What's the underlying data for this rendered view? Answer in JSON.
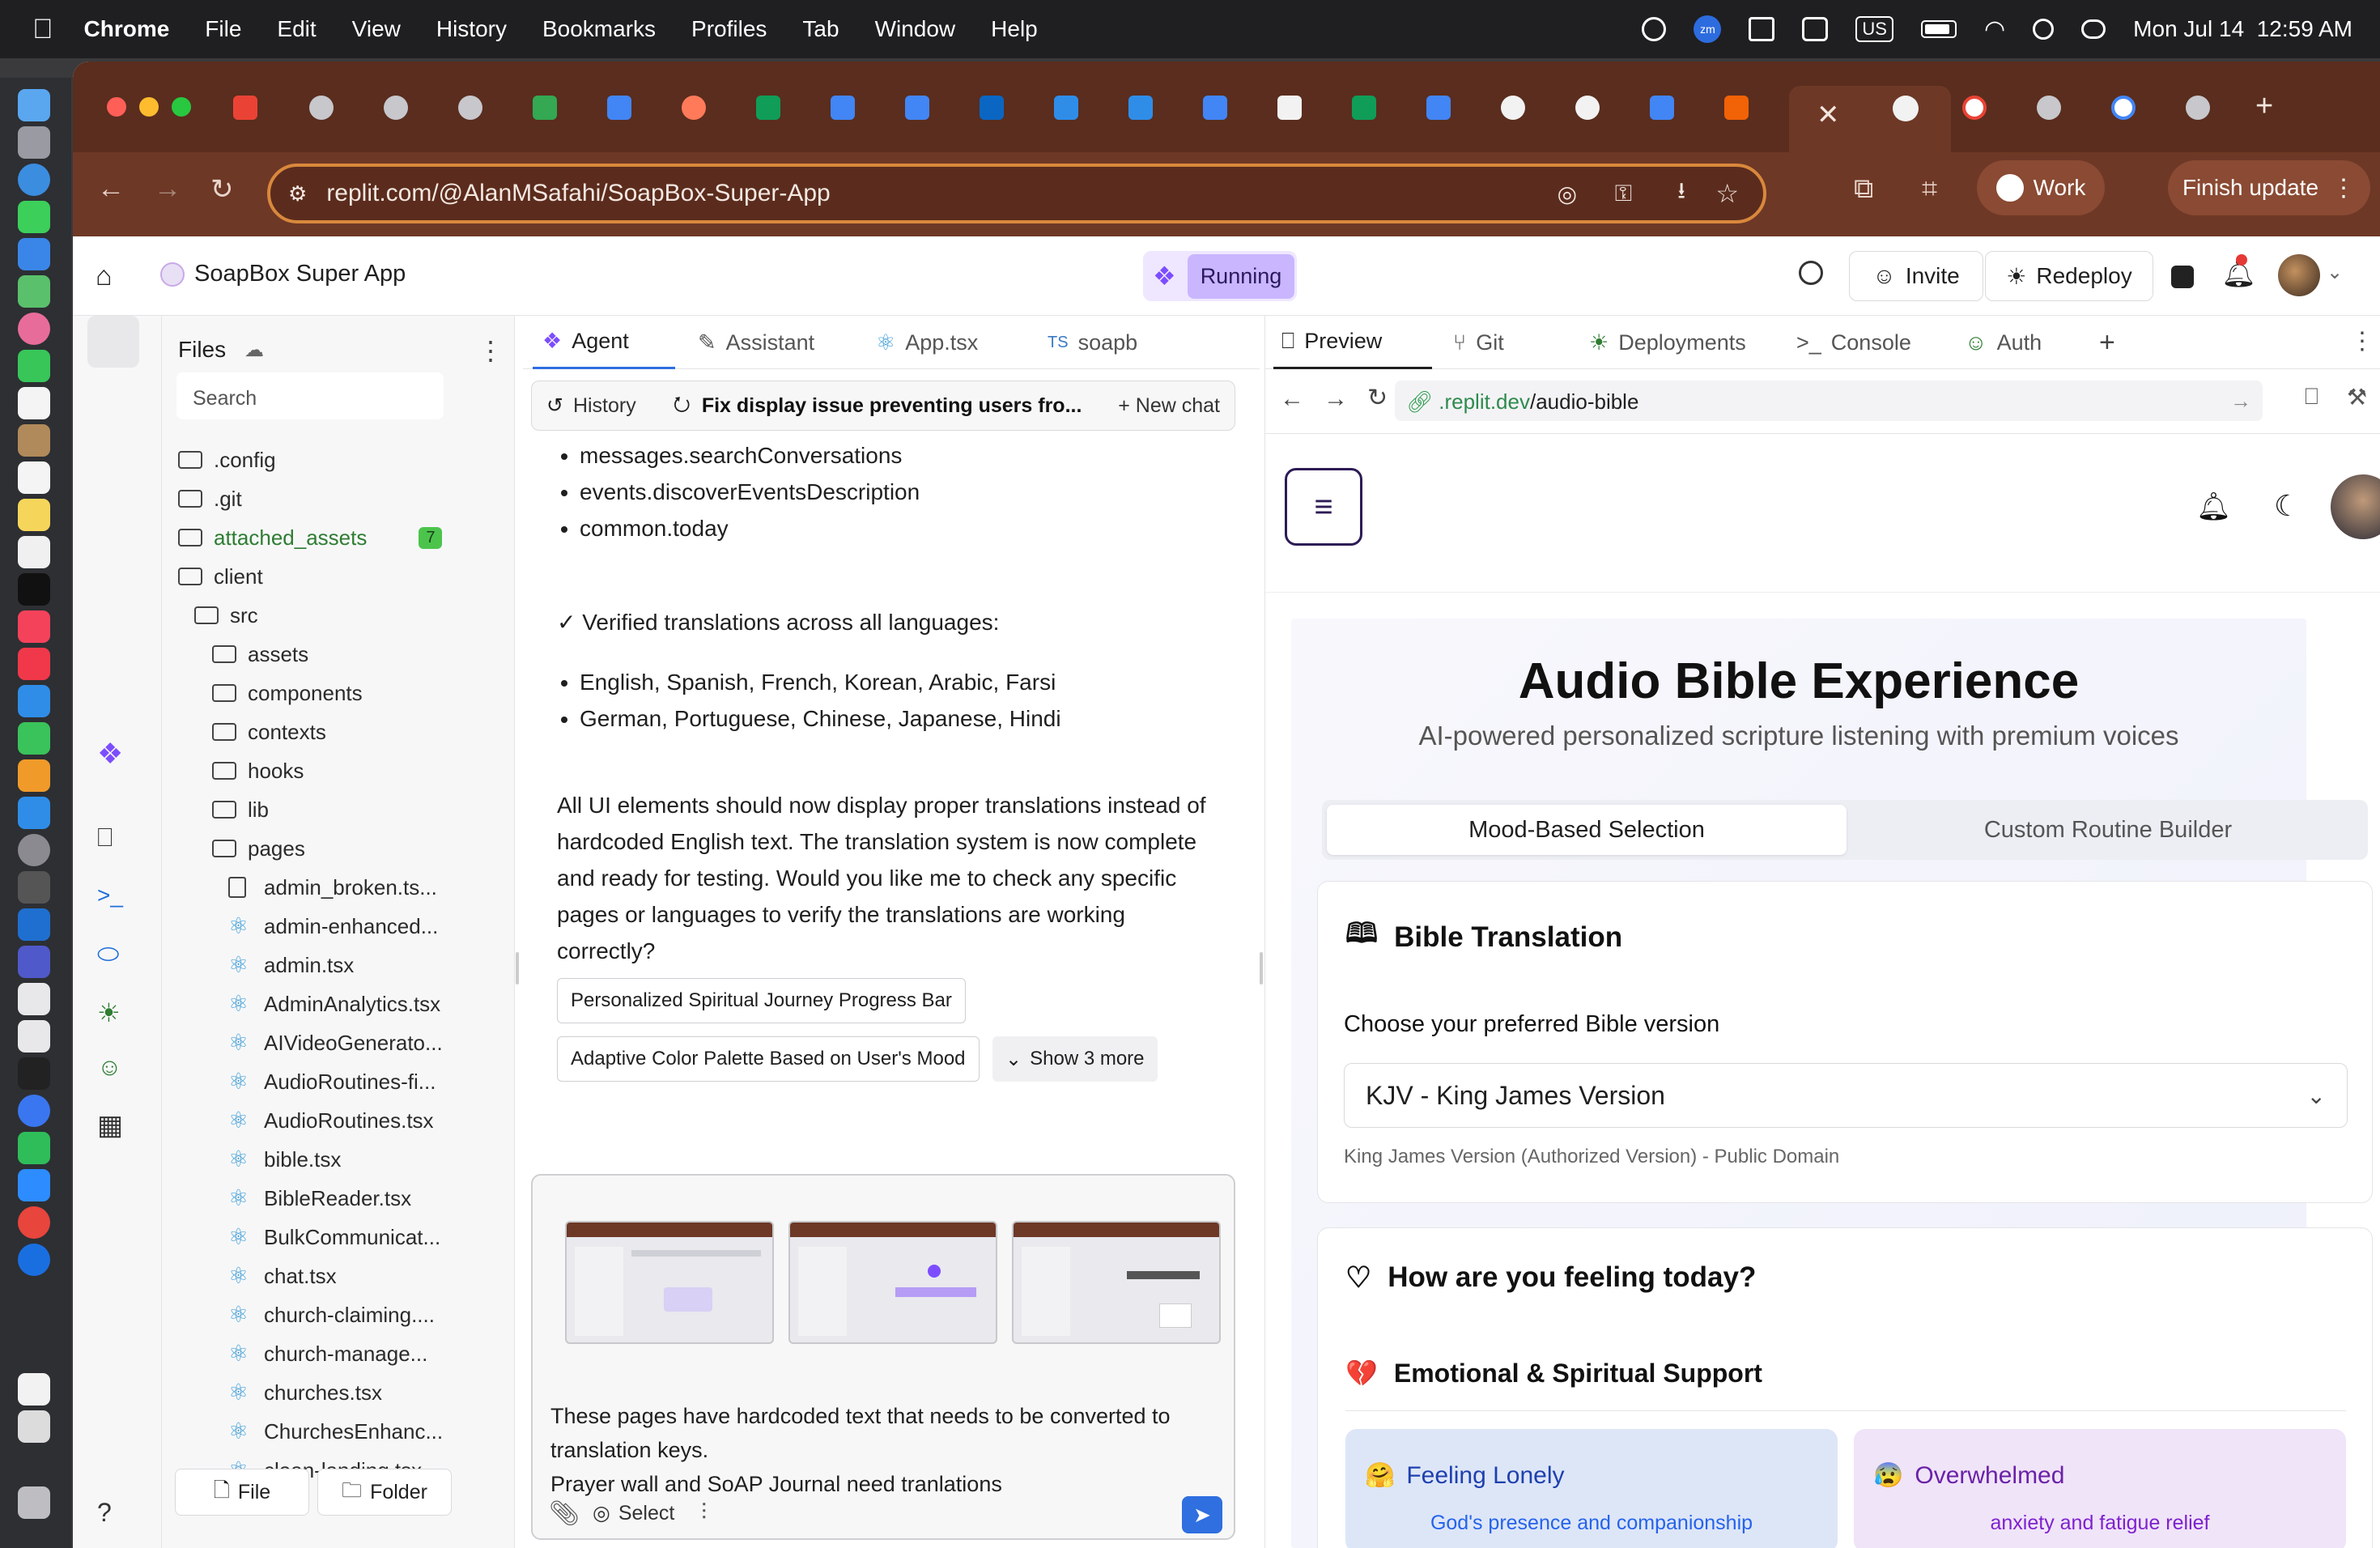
{
  "menubar": {
    "app": "Chrome",
    "items": [
      "File",
      "Edit",
      "View",
      "History",
      "Bookmarks",
      "Profiles",
      "Tab",
      "Window",
      "Help"
    ],
    "input_source": "US",
    "datetime": "Mon Jul 14  12:59 AM"
  },
  "browser": {
    "url": "replit.com/@AlanMSafahi/SoapBox-Super-App",
    "work_label": "Work",
    "finish_update_label": "Finish update"
  },
  "replit": {
    "project_name": "SoapBox Super App",
    "status": "Running",
    "invite_label": "Invite",
    "redeploy_label": "Redeploy"
  },
  "files": {
    "title": "Files",
    "search_placeholder": "Search",
    "tree": [
      {
        "name": ".config",
        "type": "folder",
        "depth": 0
      },
      {
        "name": ".git",
        "type": "folder",
        "depth": 0
      },
      {
        "name": "attached_assets",
        "type": "folder",
        "depth": 0,
        "badge": "7",
        "highlight": true
      },
      {
        "name": "client",
        "type": "folder",
        "depth": 0
      },
      {
        "name": "src",
        "type": "folder",
        "depth": 1
      },
      {
        "name": "assets",
        "type": "folder",
        "depth": 2
      },
      {
        "name": "components",
        "type": "folder",
        "depth": 2
      },
      {
        "name": "contexts",
        "type": "folder",
        "depth": 2
      },
      {
        "name": "hooks",
        "type": "folder",
        "depth": 2
      },
      {
        "name": "lib",
        "type": "folder",
        "depth": 2
      },
      {
        "name": "pages",
        "type": "folder",
        "depth": 2
      },
      {
        "name": "admin_broken.ts...",
        "type": "file",
        "depth": 3
      },
      {
        "name": "admin-enhanced...",
        "type": "react",
        "depth": 3
      },
      {
        "name": "admin.tsx",
        "type": "react",
        "depth": 3
      },
      {
        "name": "AdminAnalytics.tsx",
        "type": "react",
        "depth": 3
      },
      {
        "name": "AIVideoGenerato...",
        "type": "react",
        "depth": 3
      },
      {
        "name": "AudioRoutines-fi...",
        "type": "react",
        "depth": 3
      },
      {
        "name": "AudioRoutines.tsx",
        "type": "react",
        "depth": 3
      },
      {
        "name": "bible.tsx",
        "type": "react",
        "depth": 3
      },
      {
        "name": "BibleReader.tsx",
        "type": "react",
        "depth": 3
      },
      {
        "name": "BulkCommunicat...",
        "type": "react",
        "depth": 3
      },
      {
        "name": "chat.tsx",
        "type": "react",
        "depth": 3
      },
      {
        "name": "church-claiming....",
        "type": "react",
        "depth": 3
      },
      {
        "name": "church-manage...",
        "type": "react",
        "depth": 3
      },
      {
        "name": "churches.tsx",
        "type": "react",
        "depth": 3
      },
      {
        "name": "ChurchesEnhanc...",
        "type": "react",
        "depth": 3
      },
      {
        "name": "clean-landing.tsx",
        "type": "react",
        "depth": 3
      }
    ],
    "new_file_label": "File",
    "new_folder_label": "Folder"
  },
  "agent": {
    "tabs": [
      "Agent",
      "Assistant",
      "App.tsx",
      "soapb"
    ],
    "history_label": "History",
    "chat_title": "Fix display issue preventing users fro...",
    "new_chat_label": "New chat",
    "keys_list": [
      "messages.searchConversations",
      "events.discoverEventsDescription",
      "common.today"
    ],
    "verified": "✓ Verified translations across all languages:",
    "languages": [
      "English, Spanish, French, Korean, Arabic, Farsi",
      "German, Portuguese, Chinese, Japanese, Hindi"
    ],
    "summary": "All UI elements should now display proper translations instead of hardcoded English text. The translation system is now complete and ready for testing. Would you like me to check any specific pages or languages to verify the translations are working correctly?",
    "suggestions": [
      "Personalized Spiritual Journey Progress Bar",
      "Adaptive Color Palette Based on User's Mood"
    ],
    "show_more": "Show 3 more",
    "composer_line1": "These pages have hardcoded text that needs to be converted to translation keys.",
    "composer_line2": "Prayer wall and SoAP Journal need tranlations",
    "select_label": "Select"
  },
  "preview": {
    "tabs": [
      "Preview",
      "Git",
      "Deployments",
      "Console",
      "Auth"
    ],
    "url_domain": ".replit.dev",
    "url_path": "/audio-bible",
    "app": {
      "title": "Audio Bible Experience",
      "subtitle": "AI-powered personalized scripture listening with premium voices",
      "segments": [
        "Mood-Based Selection",
        "Custom Routine Builder"
      ],
      "translation_card": {
        "title": "Bible Translation",
        "label": "Choose your preferred Bible version",
        "selected": "KJV - King James Version",
        "note": "King James Version (Authorized Version) - Public Domain"
      },
      "mood_card": {
        "title": "How are you feeling today?",
        "section_emoji": "💔",
        "section": "Emotional & Spiritual Support",
        "moods": [
          {
            "emoji": "🤗",
            "title": "Feeling Lonely",
            "desc": "God's presence and companionship",
            "bg": "#dde6f7",
            "fg": "#1e40af"
          },
          {
            "emoji": "😰",
            "title": "Overwhelmed",
            "desc": "anxiety and fatigue relief",
            "bg": "#f0e4f8",
            "fg": "#6b21a8"
          }
        ]
      }
    }
  },
  "colors": {
    "accent": "#2f6fe0",
    "tabstrip": "#5a2d1e",
    "toolbar": "#6e3826",
    "omnibox_border": "#d9883c",
    "running": "#c9b6ff"
  }
}
